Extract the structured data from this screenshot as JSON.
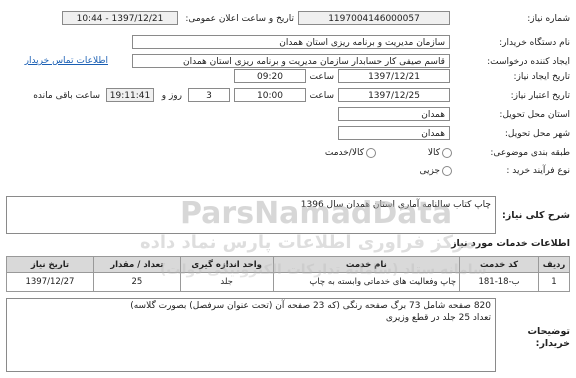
{
  "header": {
    "need_number_label": "شماره نیاز:",
    "need_number": "1197004146000057",
    "announce_label": "تاریخ و ساعت اعلان عمومی:",
    "announce_value": "1397/12/21 - 10:44",
    "buyer_label": "نام دستگاه خریدار:",
    "buyer_value": "سازمان مدیریت و برنامه ریزی استان همدان",
    "creator_label": "ایجاد کننده درخواست:",
    "creator_value": "قاسم صیفی کار حسابدار سازمان مدیریت و برنامه ریزی استان همدان",
    "contact_link": "اطلاعات تماس خریدار",
    "create_date_label": "تاریخ ایجاد نیاز:",
    "create_date": "1397/12/21",
    "create_time_label": "ساعت",
    "create_time": "09:20",
    "valid_label": "تاریخ اعتبار نیاز:",
    "valid_date": "1397/12/25",
    "valid_time_label": "ساعت",
    "valid_time": "10:00",
    "days_value": "3",
    "days_label": "روز و",
    "remaining_time": "19:11:41",
    "remaining_label": "ساعت باقی مانده",
    "province_label": "استان محل تحویل:",
    "province_value": "همدان",
    "city_label": "شهر محل تحویل:",
    "city_value": "همدان",
    "category_label": "طبقه بندی موضوعی:",
    "category_opt1": "کالا",
    "category_opt2": "کالا/خدمت",
    "process_label": "نوع فرآیند خرید :",
    "process_opt1": "جزیی"
  },
  "description": {
    "label": "شرح کلی نیاز:",
    "value": "چاپ کتاب سالنامه آماری استان همدان سال 1396"
  },
  "services": {
    "title": "اطلاعات خدمات مورد نیاز",
    "columns": [
      "ردیف",
      "کد خدمت",
      "نام خدمت",
      "واحد اندازه گیری",
      "تعداد / مقدار",
      "تاریخ نیاز"
    ],
    "rows": [
      [
        "1",
        "ب-18-181",
        "چاپ وفعالیت های خدماتی وابسته به چاپ",
        "جلد",
        "25",
        "1397/12/27"
      ]
    ]
  },
  "buyer_notes": {
    "label": "توضیحات خریدار:",
    "line1": "820 صفحه شامل 73 برگ صفحه رنگی (که 23 صفحه آن (تحت عنوان سرفصل) بصورت گلاسه)",
    "line2": "تعداد 25 جلد در قطع وزیری"
  },
  "watermark": {
    "brand": "ParsNamadData",
    "line2": "مرکز فراوری اطلاعات پارس نماد داده",
    "line3": "سامانه ستاد (سامانه تدارکات الکترونیکی دولت)"
  }
}
